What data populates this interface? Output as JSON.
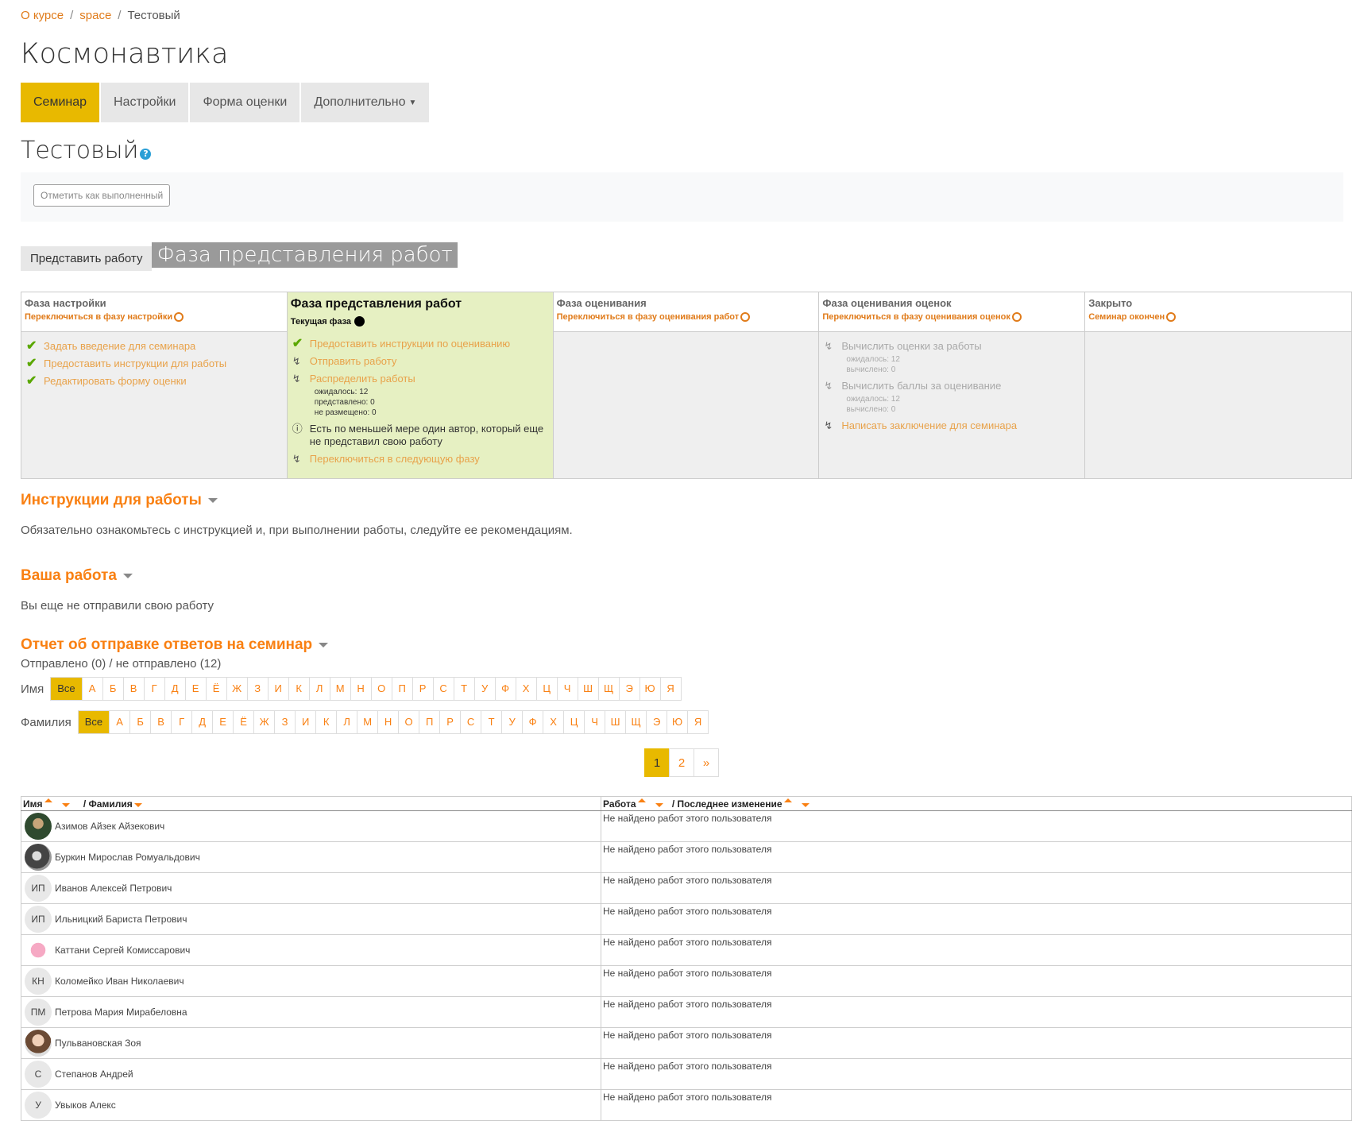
{
  "breadcrumb": {
    "items": [
      "О курсе",
      "space",
      "Тестовый"
    ]
  },
  "course_title": "Космонавтика",
  "nav": {
    "tabs": [
      "Семинар",
      "Настройки",
      "Форма оценки",
      "Дополнительно"
    ]
  },
  "activity_title": "Тестовый",
  "completion_button": "Отметить как выполненный",
  "submit_button": "Представить работу",
  "phase_banner": "Фаза представления работ",
  "phases": [
    {
      "title": "Фаза настройки",
      "switch": "Переключиться в фазу настройки",
      "tasks": [
        "Задать введение для семинара",
        "Предоставить инструкции для работы",
        "Редактировать форму оценки"
      ]
    },
    {
      "title": "Фаза представления работ",
      "current_label": "Текущая фаза",
      "tasks": [
        "Предоставить инструкции по оцениванию",
        "Отправить работу",
        "Распределить работы"
      ],
      "details": [
        "ожидалось: 12",
        "представлено: 0",
        "не размещено: 0"
      ],
      "info": "Есть по меньшей мере один автор, который еще не представил свою работу",
      "next": "Переключиться в следующую фазу"
    },
    {
      "title": "Фаза оценивания",
      "switch": "Переключиться в фазу оценивания работ"
    },
    {
      "title": "Фаза оценивания оценок",
      "switch": "Переключиться в фазу оценивания оценок",
      "tasks": [
        "Вычислить оценки за работы",
        "Вычислить баллы за оценивание",
        "Написать заключение для семинара"
      ],
      "details1": [
        "ожидалось: 12",
        "вычислено: 0"
      ],
      "details2": [
        "ожидалось: 12",
        "вычислено: 0"
      ]
    },
    {
      "title": "Закрыто",
      "switch": "Семинар окончен"
    }
  ],
  "instructions": {
    "title": "Инструкции для работы",
    "text": "Обязательно ознакомьтесь с инструкцией и, при выполнении работы, следуйте ее рекомендациям."
  },
  "your_work": {
    "title": "Ваша работа",
    "text": "Вы еще не отправили свою работу"
  },
  "report": {
    "title": "Отчет об отправке ответов на семинар",
    "summary": "Отправлено (0) / не отправлено (12)"
  },
  "initials": {
    "first_label": "Имя",
    "last_label": "Фамилия",
    "all": "Все",
    "letters": [
      "А",
      "Б",
      "В",
      "Г",
      "Д",
      "Е",
      "Ё",
      "Ж",
      "З",
      "И",
      "К",
      "Л",
      "М",
      "Н",
      "О",
      "П",
      "Р",
      "С",
      "Т",
      "У",
      "Ф",
      "Х",
      "Ц",
      "Ч",
      "Ш",
      "Щ",
      "Э",
      "Ю",
      "Я"
    ]
  },
  "pager": [
    "1",
    "2",
    "»"
  ],
  "table": {
    "headers": {
      "name": "Имя",
      "surname": "/ Фамилия",
      "work": "Работа",
      "modified": "/ Последнее изменение"
    },
    "no_work": "Не найдено работ этого пользователя",
    "rows": [
      {
        "name": "Азимов Айзек Айзекович",
        "avatar": ""
      },
      {
        "name": "Буркин Мирослав Ромуальдович",
        "avatar": ""
      },
      {
        "name": "Иванов Алексей Петрович",
        "avatar": "ИП"
      },
      {
        "name": "Ильницкий Бариста Петрович",
        "avatar": "ИП"
      },
      {
        "name": "Каттани Сергей Комиссарович",
        "avatar": ""
      },
      {
        "name": "Коломейко Иван Николаевич",
        "avatar": "КН"
      },
      {
        "name": "Петрова Мария Мирабеловна",
        "avatar": "ПМ"
      },
      {
        "name": "Пульвановская Зоя",
        "avatar": ""
      },
      {
        "name": "Степанов Андрей",
        "avatar": "С"
      },
      {
        "name": "Увыков Алекс",
        "avatar": "У"
      }
    ]
  }
}
